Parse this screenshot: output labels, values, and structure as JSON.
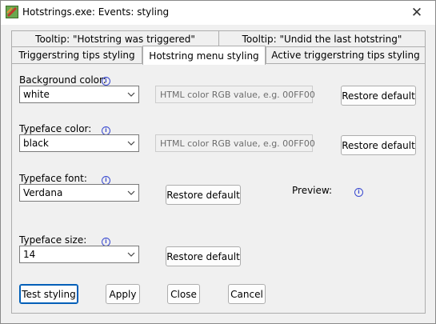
{
  "window": {
    "title": "Hotstrings.exe: Events: styling"
  },
  "tabs": {
    "top_row": [
      "Tooltip: \"Hotstring was triggered\"",
      "Tooltip: \"Undid the last hotstring\""
    ],
    "bottom_row": [
      "Triggerstring tips styling",
      "Hotstring menu styling",
      "Active triggerstring tips styling"
    ],
    "active": "Hotstring menu styling"
  },
  "form": {
    "background_color": {
      "label": "Background color:",
      "value": "white",
      "placeholder": "HTML color RGB value, e.g. 00FF00",
      "restore": "Restore default"
    },
    "typeface_color": {
      "label": "Typeface color:",
      "value": "black",
      "placeholder": "HTML color RGB value, e.g. 00FF00",
      "restore": "Restore default"
    },
    "typeface_font": {
      "label": "Typeface font:",
      "value": "Verdana",
      "restore": "Restore default"
    },
    "typeface_size": {
      "label": "Typeface size:",
      "value": "14",
      "restore": "Restore default"
    },
    "preview_label": "Preview:"
  },
  "buttons": {
    "test_styling": "Test styling",
    "apply": "Apply",
    "close": "Close",
    "cancel": "Cancel"
  },
  "icons": {
    "info": "info-icon",
    "app": "hotstrings-app-icon",
    "dropdown": "chevron-down-icon",
    "close": "close-icon"
  },
  "colors": {
    "info_accent": "#3a4ad0",
    "focus_accent": "#005fb8"
  }
}
